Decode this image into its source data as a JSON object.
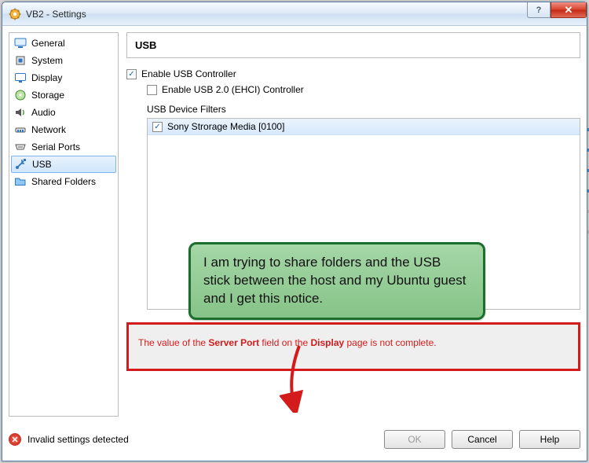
{
  "window": {
    "title": "VB2 - Settings"
  },
  "sidebar": {
    "items": [
      {
        "label": "General"
      },
      {
        "label": "System"
      },
      {
        "label": "Display"
      },
      {
        "label": "Storage"
      },
      {
        "label": "Audio"
      },
      {
        "label": "Network"
      },
      {
        "label": "Serial Ports"
      },
      {
        "label": "USB"
      },
      {
        "label": "Shared Folders"
      }
    ]
  },
  "page": {
    "heading": "USB",
    "enable_usb_label": "Enable USB Controller",
    "enable_usb_checked": true,
    "enable_ehci_label": "Enable USB 2.0 (EHCI) Controller",
    "enable_ehci_checked": false,
    "filters_label": "USB Device Filters",
    "filter0": {
      "label": "Sony Strorage Media [0100]",
      "checked": true
    }
  },
  "annotation": {
    "text": "I am trying to share folders and the USB stick between the host and my Ubuntu guest and I get this notice."
  },
  "error": {
    "prefix": "The value of the ",
    "field": "Server Port",
    "mid": " field on the ",
    "page": "Display",
    "suffix": " page is not complete."
  },
  "footer": {
    "status": "Invalid settings detected",
    "ok": "OK",
    "cancel": "Cancel",
    "help": "Help"
  }
}
